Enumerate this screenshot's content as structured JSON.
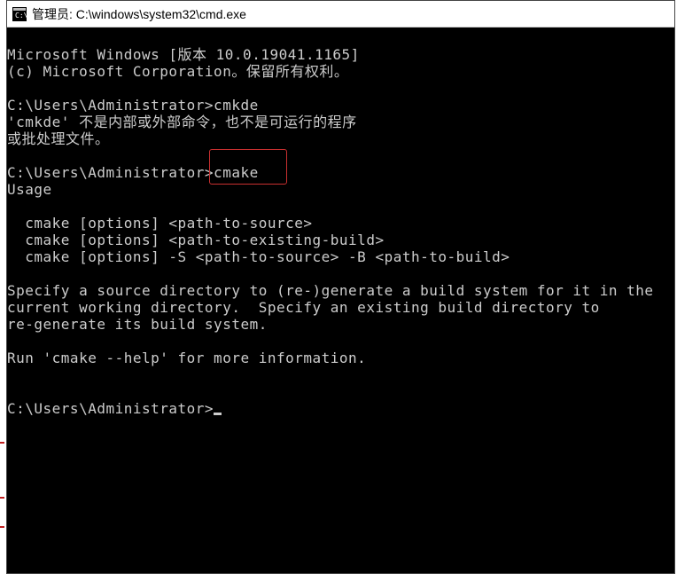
{
  "window": {
    "title": "管理员: C:\\windows\\system32\\cmd.exe"
  },
  "terminal": {
    "lines": [
      "Microsoft Windows [版本 10.0.19041.1165]",
      "(c) Microsoft Corporation。保留所有权利。",
      "",
      "C:\\Users\\Administrator>cmkde",
      "'cmkde' 不是内部或外部命令，也不是可运行的程序",
      "或批处理文件。",
      "",
      "C:\\Users\\Administrator>cmake",
      "Usage",
      "",
      "  cmake [options] <path-to-source>",
      "  cmake [options] <path-to-existing-build>",
      "  cmake [options] -S <path-to-source> -B <path-to-build>",
      "",
      "Specify a source directory to (re-)generate a build system for it in the",
      "current working directory.  Specify an existing build directory to",
      "re-generate its build system.",
      "",
      "Run 'cmake --help' for more information.",
      "",
      "",
      "C:\\Users\\Administrator>"
    ],
    "prompt": "C:\\Users\\Administrator>",
    "highlighted_command": "cmake"
  },
  "colors": {
    "terminal_bg": "#000000",
    "terminal_fg": "#cccccc",
    "highlight_border": "#c93030"
  }
}
